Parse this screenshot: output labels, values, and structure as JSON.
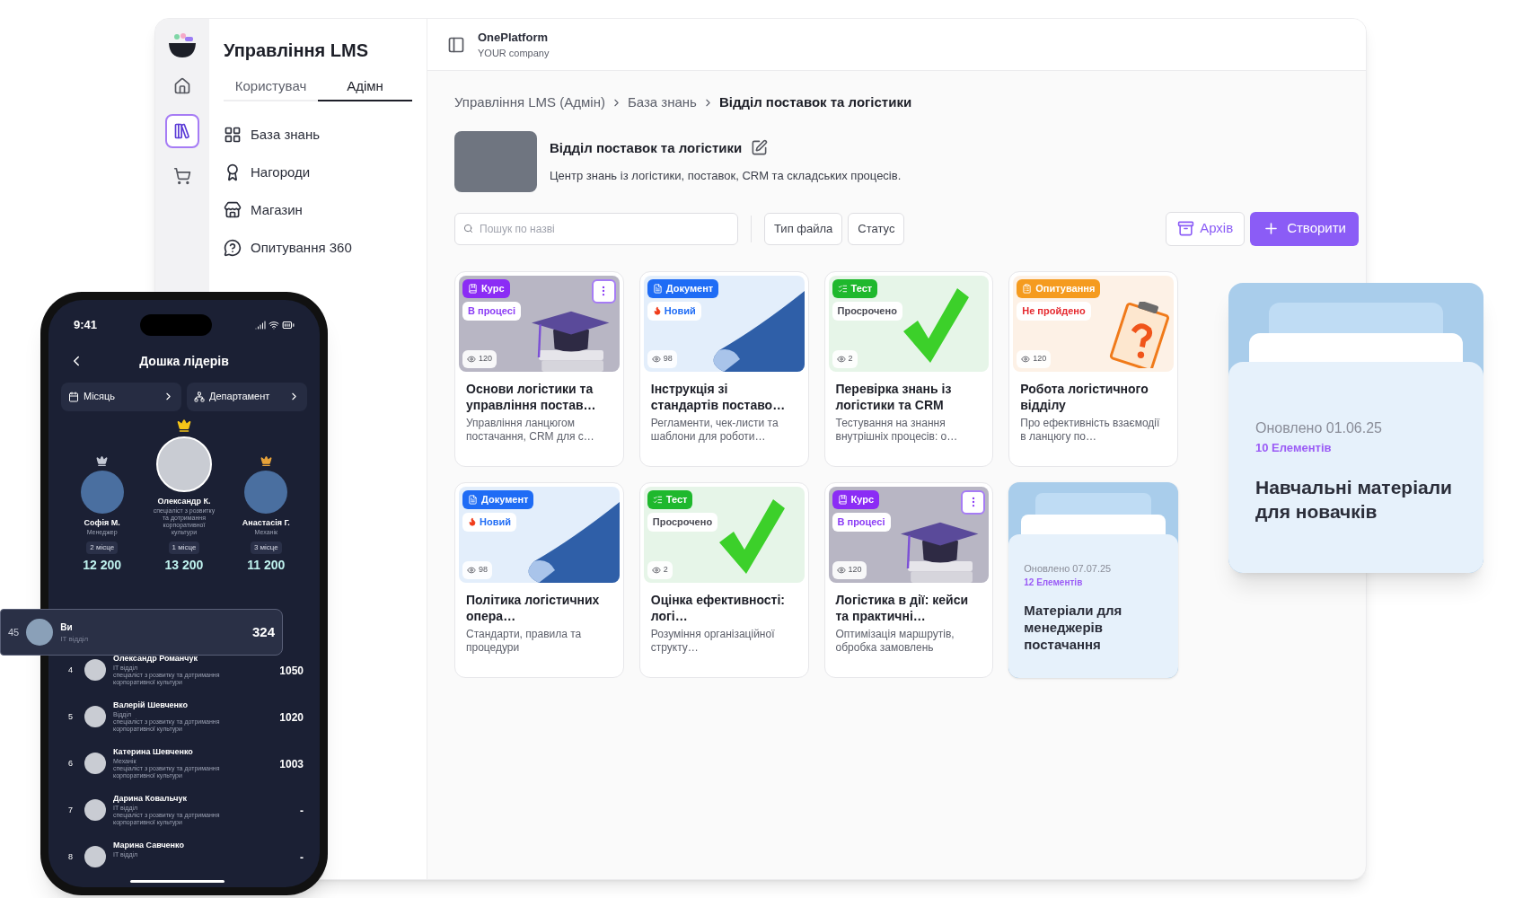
{
  "rail": {
    "items": [
      {
        "kind": "home",
        "selected": false
      },
      {
        "kind": "library",
        "selected": true
      },
      {
        "kind": "cart",
        "selected": false
      }
    ]
  },
  "nav": {
    "title": "Управління LMS",
    "tabs": [
      {
        "label": "Користувач",
        "selected": false
      },
      {
        "label": "Адімн",
        "selected": true
      }
    ],
    "items": [
      {
        "kind": "grid",
        "label": "База знань"
      },
      {
        "kind": "award",
        "label": "Нагороди"
      },
      {
        "kind": "store",
        "label": "Магазин"
      },
      {
        "kind": "survey",
        "label": "Опитування 360"
      }
    ]
  },
  "header": {
    "org": "OnePlatform",
    "company": "YOUR company"
  },
  "breadcrumbs": [
    "Управління LMS (Адмін)",
    "База знань",
    "Відділ поставок та логістики"
  ],
  "section": {
    "title": "Відділ поставок та логістики",
    "description": "Центр знань із логістики, поставок, CRM та складських процесів."
  },
  "toolbar": {
    "search_placeholder": "Пошук по назві",
    "filters": [
      "Тип файла",
      "Статус"
    ],
    "archive": "Архів",
    "create": "Створити"
  },
  "cards": [
    {
      "kind": "course",
      "type_label": "Курс",
      "status": {
        "label": "В процесі",
        "kind": "progress"
      },
      "views": "120",
      "menu": true,
      "title": "Основи логістики та управління постав…",
      "description": "Управління ланцюгом постачання, CRM для с…"
    },
    {
      "kind": "document",
      "type_label": "Документ",
      "status": {
        "label": "Новий",
        "kind": "new"
      },
      "views": "98",
      "menu": false,
      "title": "Інструкція зі стандартів поставо…",
      "description": "Регламенти, чек-листи та шаблони для роботи…"
    },
    {
      "kind": "test",
      "type_label": "Тест",
      "status": {
        "label": "Просрочено",
        "kind": "overdue"
      },
      "views": "2",
      "menu": false,
      "title": "Перевірка знань із логістики та CRM",
      "description": "Тестування на знання внутрішніх процесів: о…"
    },
    {
      "kind": "survey",
      "type_label": "Опитування",
      "status": {
        "label": "Не пройдено",
        "kind": "failed"
      },
      "views": "120",
      "menu": false,
      "title": "Робота логістичного відділу",
      "description": "Про ефективність взаємодії в ланцюгу по…"
    },
    {
      "kind": "document",
      "type_label": "Документ",
      "status": {
        "label": "Новий",
        "kind": "new"
      },
      "views": "98",
      "menu": false,
      "title": "Політика логістичних опера…",
      "description": "Стандарти, правила та процедури"
    },
    {
      "kind": "test",
      "type_label": "Тест",
      "status": {
        "label": "Просрочено",
        "kind": "overdue"
      },
      "views": "2",
      "menu": false,
      "title": "Оцінка ефективності: логі…",
      "description": "Розуміння організаційної структу…"
    },
    {
      "kind": "course",
      "type_label": "Курс",
      "status": {
        "label": "В процесі",
        "kind": "progress"
      },
      "views": "120",
      "menu": true,
      "title": "Логістика в дії: кейси та практичні…",
      "description": "Оптимізація маршрутів, обробка замовлень"
    },
    {
      "kind": "folder",
      "updated": "Оновлено 07.07.25",
      "count": "12 Елементів",
      "title": "Матеріали для менеджерів постачання"
    }
  ],
  "floating_folder": {
    "updated": "Оновлено 01.06.25",
    "count": "10 Елементів",
    "title": "Навчальні матеріали для новачків"
  },
  "phone": {
    "time": "9:41",
    "title": "Дошка лідерів",
    "filters": [
      {
        "kind": "calendar",
        "label": "Місяць"
      },
      {
        "kind": "department",
        "label": "Департамент"
      }
    ],
    "podium": [
      {
        "name": "Софія М.",
        "role": "Менеджер",
        "place": "2 місце",
        "score": "12 200",
        "color": "#c4c8d4",
        "first": false
      },
      {
        "name": "Олександр К.",
        "role": "спеціаліст з розвитку та дотримання корпоративної культури",
        "place": "1 місце",
        "score": "13 200",
        "color": "#f5c518",
        "first": true
      },
      {
        "name": "Анастасія Г.",
        "role": "Механік",
        "place": "3 місце",
        "score": "11 200",
        "color": "#e8a33a",
        "first": false
      }
    ],
    "me": {
      "rank": "45",
      "name": "Ви",
      "dept": "IT відділ",
      "score": "324"
    },
    "list": [
      {
        "rank": "4",
        "name": "Олександр Романчук",
        "dept": "IT відділ",
        "role": "спеціаліст з розвитку та дотримання корпоративної культури",
        "score": "1050"
      },
      {
        "rank": "5",
        "name": "Валерій Шевченко",
        "dept": "Відділ",
        "role": "спеціаліст з розвитку та дотримання корпоративної культури",
        "score": "1020"
      },
      {
        "rank": "6",
        "name": "Катерина Шевченко",
        "dept": "Механік",
        "role": "спеціаліст з розвитку та дотримання корпоративної культури",
        "score": "1003"
      },
      {
        "rank": "7",
        "name": "Дарина Ковальчук",
        "dept": "IT відділ",
        "role": "спеціаліст з розвитку та дотримання корпоративної культури",
        "score": "-"
      },
      {
        "rank": "8",
        "name": "Марина Савченко",
        "dept": "IT відділ",
        "score": "-"
      }
    ]
  }
}
